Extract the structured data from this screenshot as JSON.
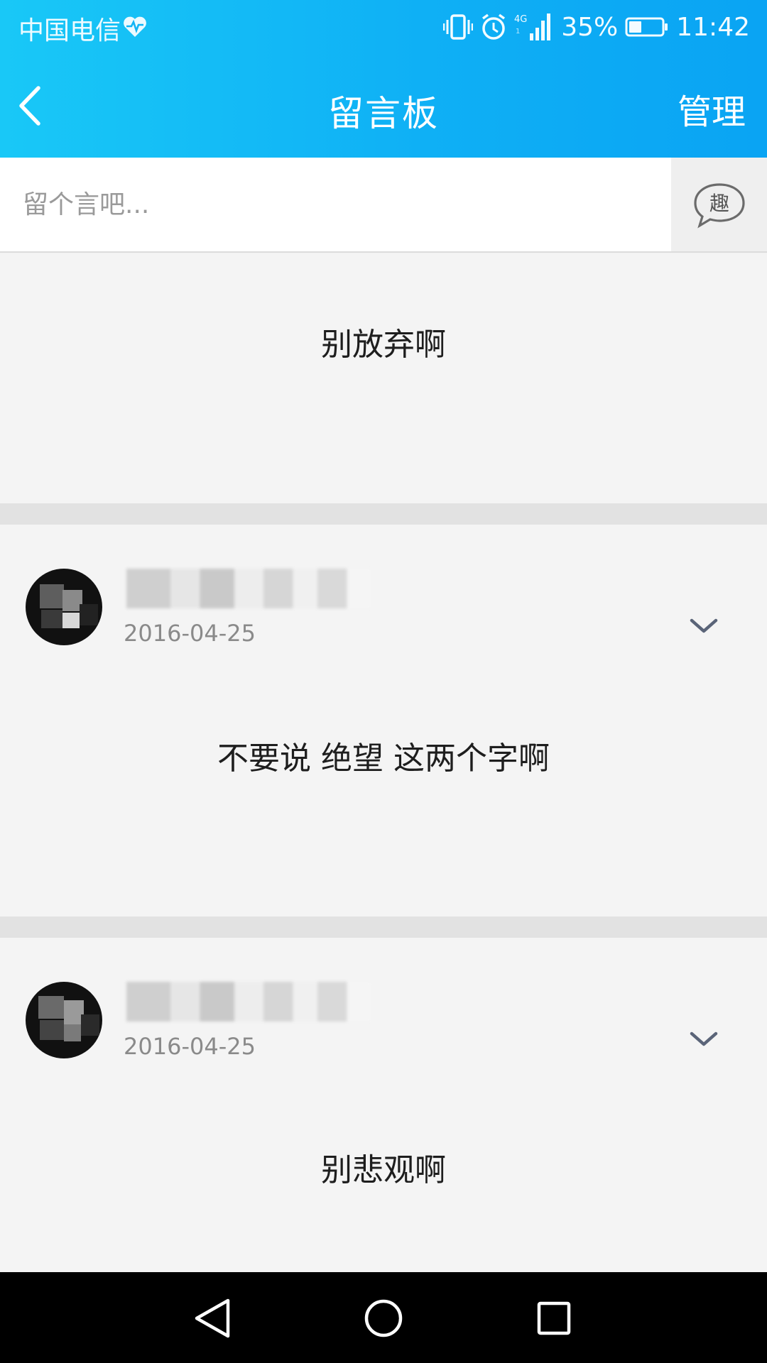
{
  "status_bar": {
    "carrier": "中国电信",
    "network": "4G",
    "battery": "35%",
    "time": "11:42",
    "icons": [
      "heart-pulse-icon",
      "vibrate-icon",
      "alarm-icon",
      "signal-icon",
      "battery-icon"
    ]
  },
  "title_bar": {
    "back_icon": "chevron-left-icon",
    "title": "留言板",
    "manage_label": "管理"
  },
  "input": {
    "placeholder": "留个言吧...",
    "fun_button_label": "趣"
  },
  "messages": [
    {
      "text": "别放弃啊"
    },
    {
      "author": "",
      "date": "2016-04-25",
      "text": "不要说 绝望 这两个字啊"
    },
    {
      "author": "",
      "date": "2016-04-25",
      "text": "别悲观啊"
    }
  ],
  "nav_bar": {
    "icons": [
      "nav-back-icon",
      "nav-home-icon",
      "nav-recents-icon"
    ]
  },
  "colors": {
    "header_start": "#19c8f7",
    "header_end": "#0aa4f3",
    "card_bg": "#f4f4f4",
    "separator": "#e2e2e2",
    "chevron": "#5a6478"
  }
}
